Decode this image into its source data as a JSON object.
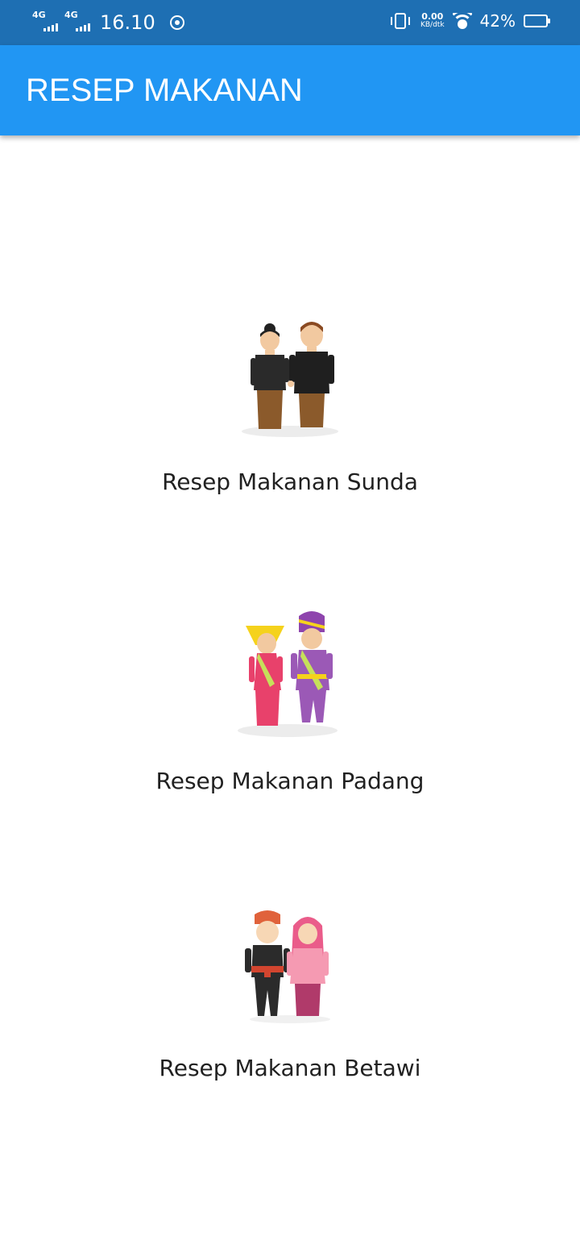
{
  "status_bar": {
    "network_1": "4G",
    "network_2": "4G",
    "time": "16.10",
    "speed_value": "0.00",
    "speed_unit": "KB/dtk",
    "battery_percent": "42%",
    "battery_level": 0.42
  },
  "app_bar": {
    "title": "RESEP MAKANAN"
  },
  "menu": [
    {
      "label": "Resep Makanan Sunda",
      "icon": "sunda-couple-icon"
    },
    {
      "label": "Resep Makanan Padang",
      "icon": "padang-couple-icon"
    },
    {
      "label": "Resep Makanan Betawi",
      "icon": "betawi-couple-icon"
    }
  ],
  "colors": {
    "status_bar": "#1e6fb3",
    "app_bar": "#2196f3",
    "text": "#212121"
  }
}
